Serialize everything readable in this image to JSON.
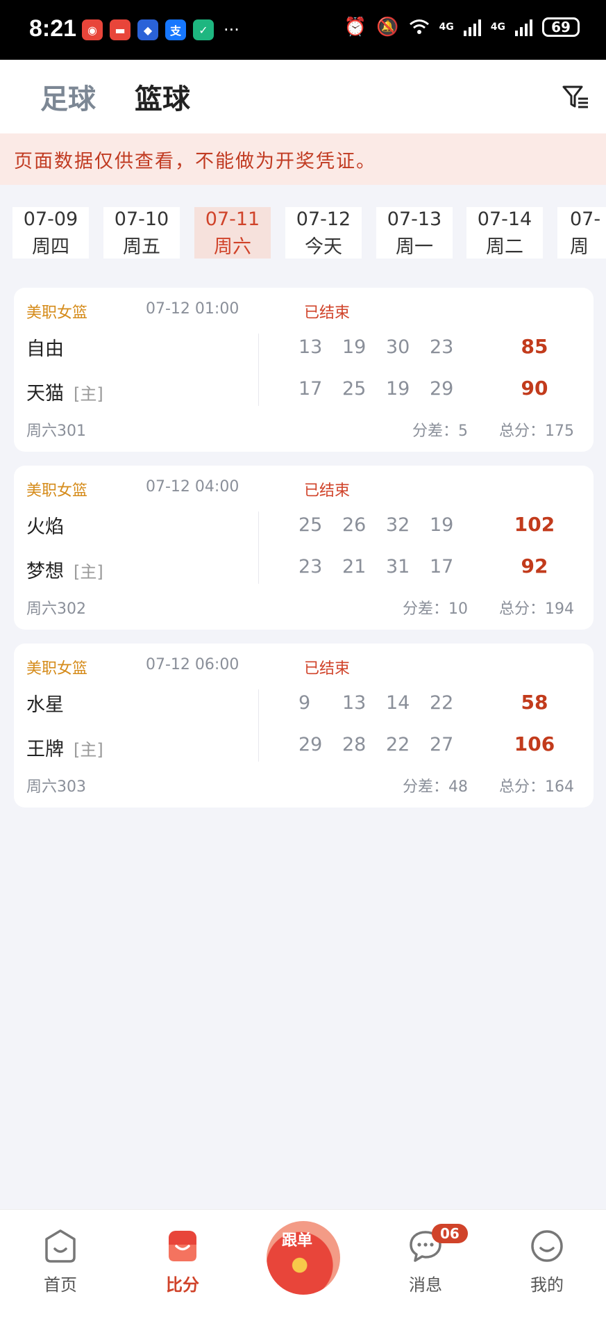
{
  "status_bar": {
    "time": "8:21",
    "battery": "69",
    "network_1": "4G",
    "network_2": "4G",
    "more": "···"
  },
  "header": {
    "tabs": [
      {
        "label": "足球",
        "active": false
      },
      {
        "label": "篮球",
        "active": true
      }
    ],
    "filter_icon": "filter-icon"
  },
  "notice": "页面数据仅供查看，不能做为开奖凭证。",
  "dates": [
    {
      "date": "07-09",
      "day": "周四",
      "active": false
    },
    {
      "date": "07-10",
      "day": "周五",
      "active": false
    },
    {
      "date": "07-11",
      "day": "周六",
      "active": true
    },
    {
      "date": "07-12",
      "day": "今天",
      "active": false
    },
    {
      "date": "07-13",
      "day": "周一",
      "active": false
    },
    {
      "date": "07-14",
      "day": "周二",
      "active": false
    },
    {
      "date": "07-",
      "day": "周",
      "active": false
    }
  ],
  "home_mark": "[主]",
  "matches": [
    {
      "league": "美职女篮",
      "time": "07-12 01:00",
      "status": "已结束",
      "team1": "自由",
      "team2": "天猫",
      "q1": [
        "13",
        "19",
        "30",
        "23"
      ],
      "q2": [
        "17",
        "25",
        "19",
        "29"
      ],
      "total1": "85",
      "total2": "90",
      "code": "周六301",
      "diff": "分差：5",
      "sum": "总分：175"
    },
    {
      "league": "美职女篮",
      "time": "07-12 04:00",
      "status": "已结束",
      "team1": "火焰",
      "team2": "梦想",
      "q1": [
        "25",
        "26",
        "32",
        "19"
      ],
      "q2": [
        "23",
        "21",
        "31",
        "17"
      ],
      "total1": "102",
      "total2": "92",
      "code": "周六302",
      "diff": "分差：10",
      "sum": "总分：194"
    },
    {
      "league": "美职女篮",
      "time": "07-12 06:00",
      "status": "已结束",
      "team1": "水星",
      "team2": "王牌",
      "q1": [
        "9",
        "13",
        "14",
        "22"
      ],
      "q2": [
        "29",
        "28",
        "22",
        "27"
      ],
      "total1": "58",
      "total2": "106",
      "code": "周六303",
      "diff": "分差：48",
      "sum": "总分：164"
    }
  ],
  "bottom_nav": {
    "home": "首页",
    "score": "比分",
    "follow": "跟单",
    "messages": "消息",
    "messages_badge": "06",
    "mine": "我的"
  },
  "colors": {
    "accent": "#d0432a",
    "league": "#d58b1a",
    "notice_bg": "#fbeae6",
    "background": "#f3f4f9"
  }
}
